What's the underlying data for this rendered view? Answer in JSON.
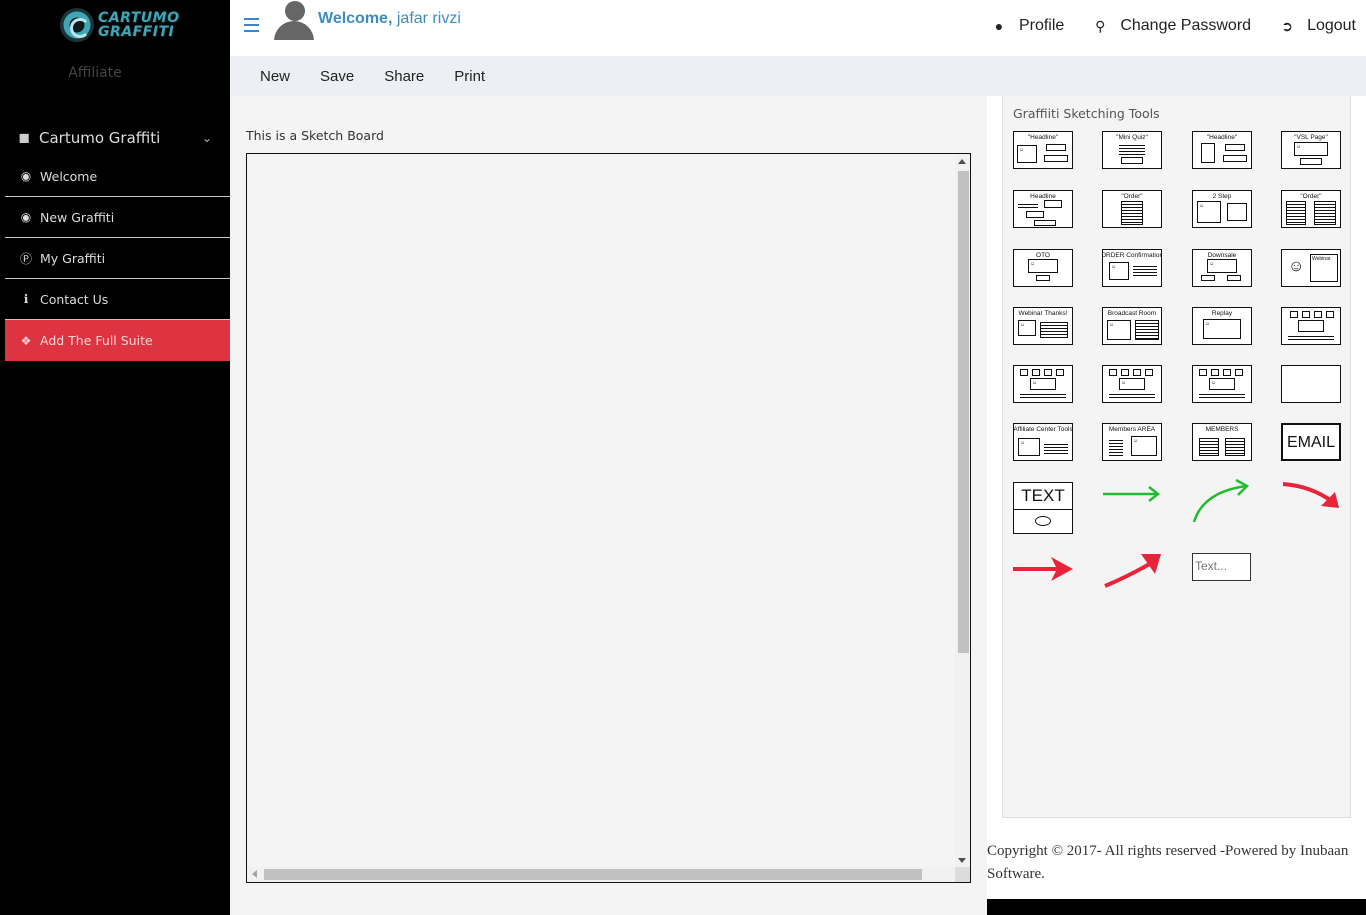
{
  "brand": {
    "logo_line1": "CARTUMO",
    "logo_line2": "GRAFFITI",
    "role": "Affiliate"
  },
  "sidebar": {
    "group_label": "Cartumo Graffiti",
    "items": [
      {
        "label": "Welcome",
        "icon": "eye-icon"
      },
      {
        "label": "New Graffiti",
        "icon": "palette-icon"
      },
      {
        "label": "My Graffiti",
        "icon": "p-badge-icon"
      },
      {
        "label": "Contact Us",
        "icon": "info-icon"
      },
      {
        "label": "Add The Full Suite",
        "icon": "ticket-icon"
      }
    ],
    "accent_color": "#de3340"
  },
  "header": {
    "welcome_prefix": "Welcome,",
    "user_name": "jafar rivzi",
    "actions": [
      {
        "label": "Profile",
        "icon": "user-icon"
      },
      {
        "label": "Change Password",
        "icon": "key-icon"
      },
      {
        "label": "Logout",
        "icon": "sign-out-icon"
      }
    ],
    "link_color": "#3c8dbc"
  },
  "toolbar": {
    "new": "New",
    "save": "Save",
    "share": "Share",
    "print": "Print"
  },
  "board": {
    "label": "This is a Sketch Board"
  },
  "tools": {
    "title": "Graffiiti Sketching Tools",
    "tiles": [
      "\"Headline\"",
      "\"Mini Quiz\"",
      "\"Headline\"",
      "\"VSL Page\"",
      "Headline",
      "\"Order\"",
      "2 Step",
      "\"Order\"",
      "OTO",
      "ORDER  Confirmation",
      "Downsale",
      "Webinar",
      "Webinar Thanks!",
      "Broadcast Room",
      "Replay",
      "",
      "",
      "",
      "",
      "",
      "Affiliate Center Tools",
      "Members AREA",
      "MEMBERS",
      "EMAIL"
    ],
    "text_tile": "TEXT",
    "text_placeholder": "Text...",
    "arrow_colors": {
      "green": "#22bb33",
      "red": "#e8243a"
    }
  },
  "footer": {
    "copyright": "Copyright © 2017- All rights reserved -Powered by Inubaan Software."
  }
}
